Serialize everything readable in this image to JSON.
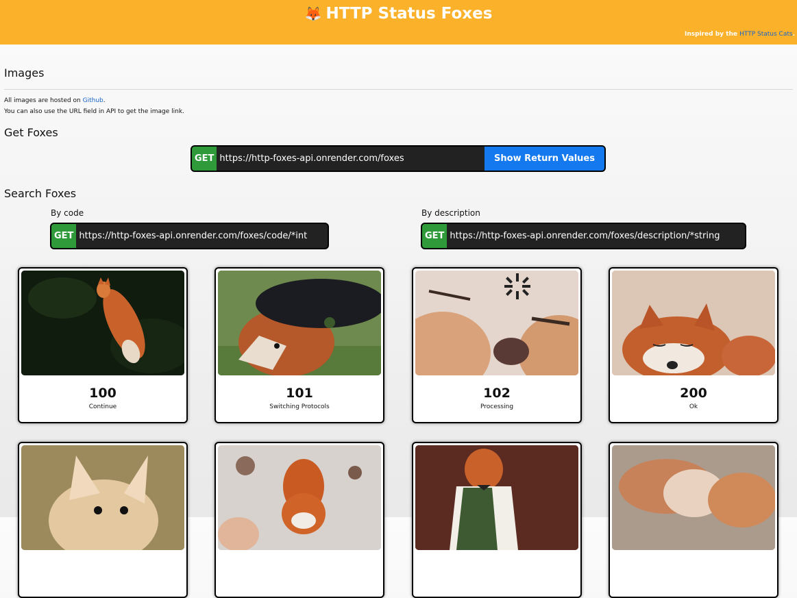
{
  "header": {
    "title": "HTTP Status Foxes",
    "fox_emoji": "🦊",
    "inspired_prefix": "Inspired by the ",
    "inspired_link": "HTTP Status Cats",
    "inspired_suffix": "."
  },
  "images_section": {
    "heading": "Images",
    "line1_prefix": "All images are hosted on ",
    "line1_link": "Github",
    "line1_suffix": ".",
    "line2": "You can also use the URL field in API to get the image link."
  },
  "get_foxes": {
    "heading": "Get Foxes",
    "method": "GET",
    "url": "https://http-foxes-api.onrender.com/foxes",
    "button": "Show Return Values"
  },
  "search_foxes": {
    "heading": "Search Foxes",
    "by_code": {
      "label": "By code",
      "method": "GET",
      "url": "https://http-foxes-api.onrender.com/foxes/code/*int"
    },
    "by_description": {
      "label": "By description",
      "method": "GET",
      "url": "https://http-foxes-api.onrender.com/foxes/description/*string"
    }
  },
  "cards": [
    {
      "code": "100",
      "desc": "Continue"
    },
    {
      "code": "101",
      "desc": "Switching Protocols"
    },
    {
      "code": "102",
      "desc": "Processing"
    },
    {
      "code": "200",
      "desc": "Ok"
    },
    {
      "code": "",
      "desc": ""
    },
    {
      "code": "",
      "desc": ""
    },
    {
      "code": "",
      "desc": ""
    },
    {
      "code": "",
      "desc": ""
    }
  ],
  "colors": {
    "header": "#fbb22a",
    "get_badge": "#2e9a3a",
    "button": "#1479ef",
    "link": "#1a64c8"
  }
}
